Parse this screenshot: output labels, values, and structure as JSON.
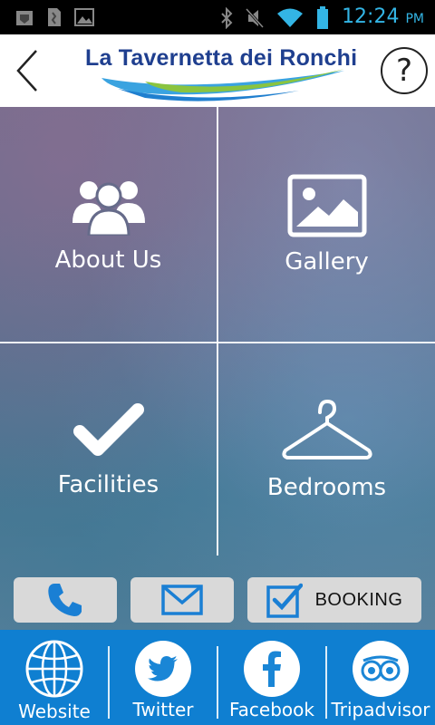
{
  "status_bar": {
    "time": "12:24",
    "ampm": "PM",
    "accent_color": "#33b5e5",
    "left_icons": [
      "usb-icon",
      "file-icon",
      "image-icon"
    ],
    "right_icons": [
      "bluetooth-icon",
      "mute-icon",
      "wifi-icon",
      "battery-icon"
    ]
  },
  "header": {
    "logo_text": "La Tavernetta dei Ronchi",
    "help_label": "?"
  },
  "tiles": [
    {
      "label": "About Us",
      "icon": "users-icon"
    },
    {
      "label": "Gallery",
      "icon": "image-icon"
    },
    {
      "label": "Facilities",
      "icon": "checkmark-icon"
    },
    {
      "label": "Bedrooms",
      "icon": "hanger-icon"
    }
  ],
  "actions": {
    "phone_icon": "phone-icon",
    "mail_icon": "mail-icon",
    "booking_label": "BOOKING"
  },
  "footer": {
    "color": "#0f7fd1",
    "items": [
      {
        "label": "Website",
        "icon": "globe-icon"
      },
      {
        "label": "Twitter",
        "icon": "twitter-icon"
      },
      {
        "label": "Facebook",
        "icon": "facebook-icon"
      },
      {
        "label": "Tripadvisor",
        "icon": "tripadvisor-icon"
      }
    ]
  }
}
